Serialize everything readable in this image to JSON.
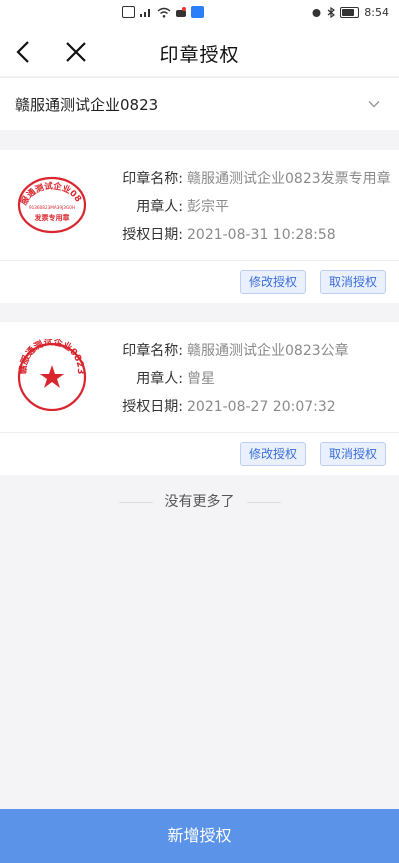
{
  "status_bar": {
    "time": "8:54"
  },
  "nav": {
    "title": "印章授权"
  },
  "company": {
    "name": "赣服通测试企业0823"
  },
  "labels": {
    "seal_name": "印章名称:",
    "user": "用章人:",
    "date": "授权日期:"
  },
  "seals": [
    {
      "name": "赣服通测试企业0823发票专用章",
      "user": "彭宗平",
      "date": "2021-08-31 10:28:58",
      "stamp_text": "赣服通测试企业0823",
      "stamp_sub": "发票专用章",
      "stamp_code": "91360823MA39J3G0H",
      "type": "oval",
      "modify_label": "修改授权",
      "cancel_label": "取消授权"
    },
    {
      "name": "赣服通测试企业0823公章",
      "user": "曾星",
      "date": "2021-08-27 20:07:32",
      "stamp_text": "赣服通测试企业0823",
      "type": "round",
      "modify_label": "修改授权",
      "cancel_label": "取消授权"
    }
  ],
  "footer": {
    "no_more": "没有更多了"
  },
  "bottom_button": {
    "label": "新增授权"
  },
  "colors": {
    "primary": "#5b93e8",
    "stamp_red": "#d9262e",
    "link_blue": "#3b6fd8"
  }
}
